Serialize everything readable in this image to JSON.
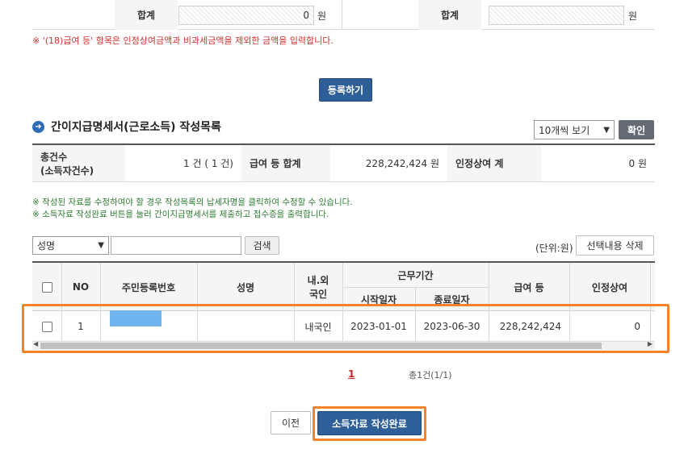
{
  "top_summary": {
    "left_label": "합계",
    "left_value": "0",
    "left_unit": "원",
    "right_label": "합계",
    "right_value": "",
    "right_unit": "원"
  },
  "note_red": "※ '(18)급여 등' 항목은 인정상여금액과 비과세금액을 제외한 금액을 입력합니다.",
  "register_button": "등록하기",
  "section": {
    "title": "간이지급명세서(근로소득) 작성목록",
    "page_size_select": "10개씩 보기",
    "confirm_button": "확인"
  },
  "summary": {
    "count_label_line1": "총건수",
    "count_label_line2": "(소득자건수)",
    "count_value": "1 건 ( 1 건)",
    "pay_label": "급여 등 합계",
    "pay_value": "228,242,424 원",
    "bonus_label": "인정상여 계",
    "bonus_value": "0 원"
  },
  "notes_green": [
    "※ 작성된 자료를 수정하여야 할 경우 작성목록의 납세자명을 클릭하여 수정할 수 있습니다.",
    "※ 소득자료 작성완료 버튼을 눌러 간이지급명세서를 제출하고 접수증을 출력합니다."
  ],
  "search": {
    "select_value": "성명",
    "input_value": "",
    "search_button": "검색",
    "unit_text": "(단위:원)",
    "delete_button": "선택내용 삭제"
  },
  "table": {
    "headers": {
      "no": "NO",
      "rrn": "주민등록번호",
      "name": "성명",
      "nationality_line1": "내.외",
      "nationality_line2": "국인",
      "work_period": "근무기간",
      "start_date": "시작일자",
      "end_date": "종료일자",
      "pay": "급여 등",
      "bonus": "인정상여"
    },
    "rows": [
      {
        "no": "1",
        "rrn": "",
        "name": "",
        "nationality": "내국인",
        "start_date": "2023-01-01",
        "end_date": "2023-06-30",
        "pay": "228,242,424",
        "bonus": "0"
      }
    ]
  },
  "pagination": {
    "current_page": "1",
    "total_text": "총1건(1/1)"
  },
  "footer": {
    "prev_button": "이전",
    "complete_button": "소득자료 작성완료"
  },
  "colors": {
    "highlight": "#f5822a",
    "primary_button": "#2e5f99",
    "redact_block": "#6fb3f0"
  }
}
